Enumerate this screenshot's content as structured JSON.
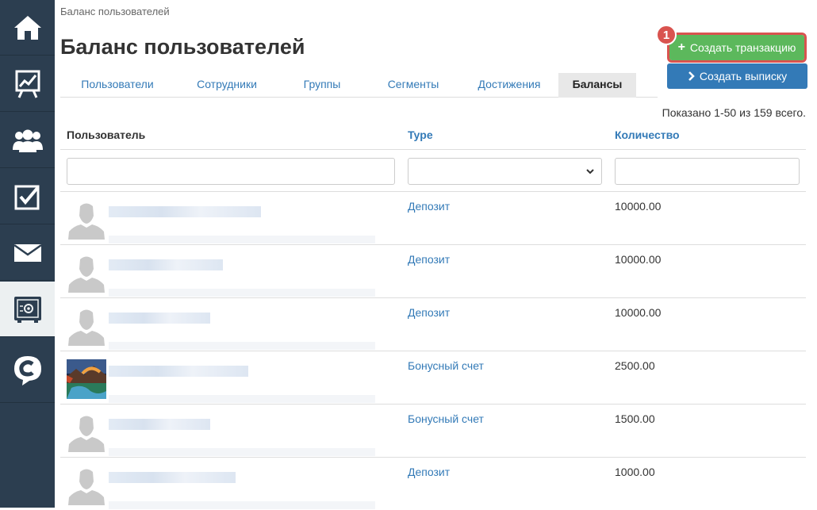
{
  "sidebar": {
    "items": [
      {
        "icon": "home-icon",
        "active": false
      },
      {
        "icon": "chart-presentation-icon",
        "active": false
      },
      {
        "icon": "users-group-icon",
        "active": false
      },
      {
        "icon": "checkbox-icon",
        "active": false
      },
      {
        "icon": "mail-icon",
        "active": false
      },
      {
        "icon": "safe-icon",
        "active": true
      },
      {
        "icon": "brand-logo-icon",
        "active": false
      }
    ]
  },
  "breadcrumb": "Баланс пользователей",
  "page_title": "Баланс пользователей",
  "tabs": [
    {
      "label": "Пользователи",
      "active": false
    },
    {
      "label": "Сотрудники",
      "active": false
    },
    {
      "label": "Группы",
      "active": false
    },
    {
      "label": "Сегменты",
      "active": false
    },
    {
      "label": "Достижения",
      "active": false
    },
    {
      "label": "Балансы",
      "active": true
    }
  ],
  "actions": {
    "badge": "1",
    "create_transaction": "Создать транзакцию",
    "create_statement": "Создать выписку"
  },
  "summary": "Показано 1-50 из 159 всего.",
  "table": {
    "headers": {
      "user": "Пользователь",
      "type": "Type",
      "quantity": "Количество"
    },
    "filters": {
      "user": "",
      "type": "",
      "quantity": ""
    },
    "rows": [
      {
        "avatar": "default",
        "type": "Депозит",
        "quantity": "10000.00"
      },
      {
        "avatar": "default",
        "type": "Депозит",
        "quantity": "10000.00"
      },
      {
        "avatar": "default",
        "type": "Депозит",
        "quantity": "10000.00"
      },
      {
        "avatar": "photo",
        "type": "Бонусный счет",
        "quantity": "2500.00"
      },
      {
        "avatar": "default",
        "type": "Бонусный счет",
        "quantity": "1500.00"
      },
      {
        "avatar": "default",
        "type": "Депозит",
        "quantity": "1000.00"
      }
    ]
  },
  "colors": {
    "sidebar": "#2c3e50",
    "link": "#337ab7",
    "green": "#5cb85c",
    "blue": "#337ab7",
    "highlight": "#d9534f"
  }
}
